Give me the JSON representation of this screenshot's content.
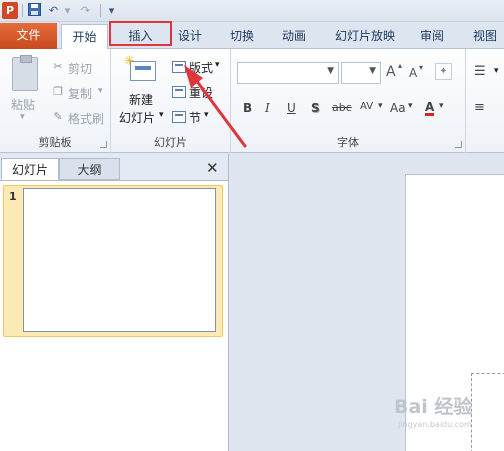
{
  "qat": {
    "app_icon": "P",
    "icons": [
      "save-icon",
      "undo-icon",
      "redo-icon",
      "customize-icon"
    ],
    "undo_glyph": "↶",
    "redo_glyph": "↷",
    "dropdown_glyph": "▾"
  },
  "tabs": {
    "file": "文件",
    "items": [
      "开始",
      "插入",
      "设计",
      "切换",
      "动画",
      "幻灯片放映",
      "审阅",
      "视图"
    ],
    "active": "开始",
    "highlighted": "插入",
    "highlight_color": "#e0353d"
  },
  "ribbon": {
    "clipboard": {
      "label": "剪贴板",
      "paste": "粘贴",
      "cut": "剪切",
      "copy": "复制",
      "format_painter": "格式刷"
    },
    "slides": {
      "label": "幻灯片",
      "new_slide_line1": "新建",
      "new_slide_line2": "幻灯片",
      "layout": "版式",
      "reset": "重设",
      "section": "节"
    },
    "font": {
      "label": "字体",
      "font_name_value": "",
      "font_size_value": "",
      "grow": "A",
      "shrink": "A",
      "bold": "B",
      "italic": "I",
      "underline": "U",
      "shadow": "S",
      "strikethrough": "abc",
      "spacing": "AV",
      "case": "Aa",
      "color": "A"
    }
  },
  "panel": {
    "tab_slides": "幻灯片",
    "tab_outline": "大纲",
    "close": "✕",
    "slide_number": "1"
  },
  "annotation": {
    "arrow_color": "#e0353d"
  },
  "watermark": {
    "text": "Bai 经验",
    "sub": "jingyan.baidu.com"
  }
}
